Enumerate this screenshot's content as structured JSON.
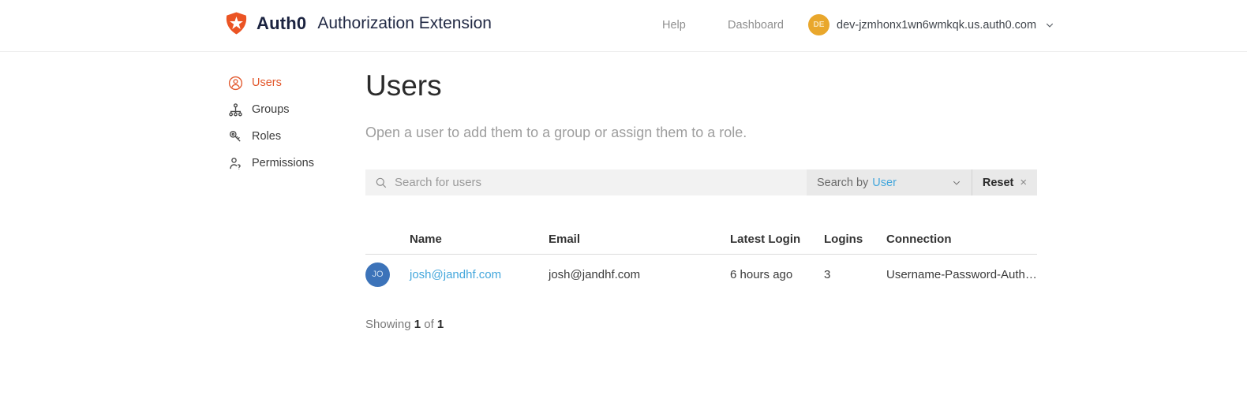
{
  "header": {
    "brand": "Auth0",
    "app_title": "Authorization Extension",
    "help_label": "Help",
    "dashboard_label": "Dashboard",
    "avatar_initials": "DE",
    "tenant": "dev-jzmhonx1wn6wmkqk.us.auth0.com"
  },
  "sidebar": {
    "items": [
      {
        "label": "Users"
      },
      {
        "label": "Groups"
      },
      {
        "label": "Roles"
      },
      {
        "label": "Permissions"
      }
    ]
  },
  "main": {
    "title": "Users",
    "subtitle": "Open a user to add them to a group or assign them to a role.",
    "search": {
      "placeholder": "Search for users",
      "search_by_label": "Search by",
      "search_by_value": "User",
      "reset_label": "Reset",
      "reset_close": "×"
    },
    "table": {
      "columns": [
        "Name",
        "Email",
        "Latest Login",
        "Logins",
        "Connection"
      ],
      "rows": [
        {
          "avatar_initials": "JO",
          "name": "josh@jandhf.com",
          "email": "josh@jandhf.com",
          "latest_login": "6 hours ago",
          "logins": "3",
          "connection": "Username-Password-Auth…"
        }
      ]
    },
    "footer": {
      "showing_label": "Showing",
      "current": "1",
      "of_label": "of",
      "total": "1"
    }
  },
  "colors": {
    "accent_orange": "#eb5424",
    "sidebar_active_orange": "#e2572b",
    "link_blue": "#44a7dc",
    "avatar_amber": "#e9a72c",
    "avatar_blue": "#3c73b9"
  }
}
